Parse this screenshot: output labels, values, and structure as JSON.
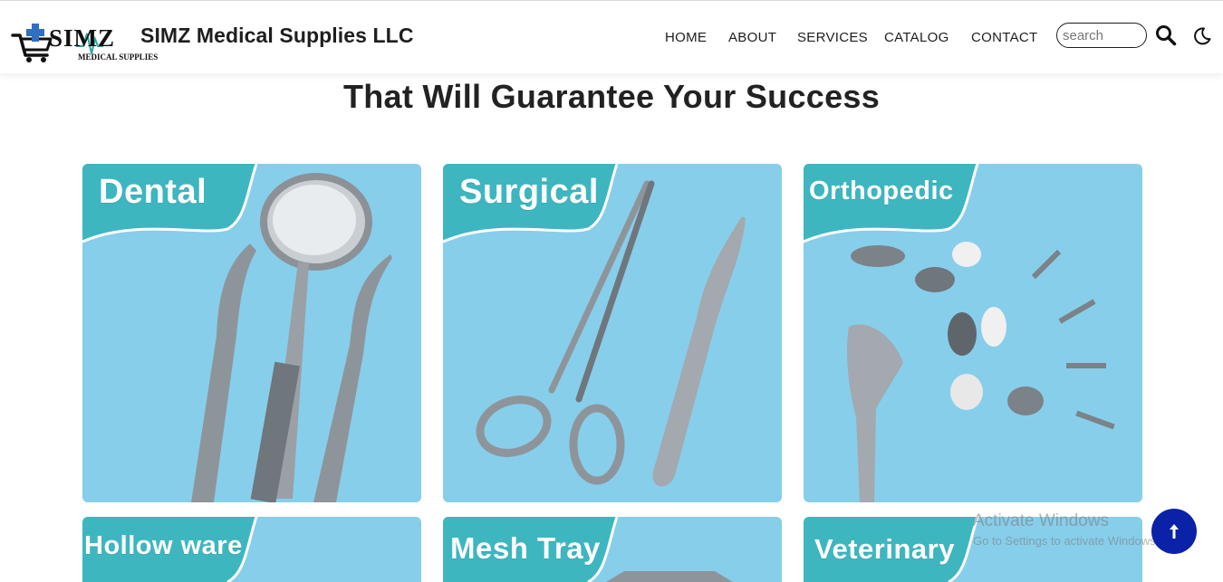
{
  "brand": {
    "name": "SIMZ Medical Supplies LLC",
    "logo_text": "SIMZ",
    "logo_subtext": "MEDICAL SUPPLIES"
  },
  "nav": {
    "items": [
      {
        "label": "HOME"
      },
      {
        "label": "ABOUT"
      },
      {
        "label": "SERVICES"
      },
      {
        "label": "CATALOG"
      },
      {
        "label": "CONTACT"
      }
    ]
  },
  "search": {
    "placeholder": "search",
    "value": ""
  },
  "icons": {
    "search": "search-icon",
    "theme": "moon-icon",
    "to_top": "arrow-up-icon"
  },
  "heading": {
    "line2": "That Will Guarantee Your Success"
  },
  "categories": [
    {
      "label": "Dental"
    },
    {
      "label": "Surgical"
    },
    {
      "label": "Orthopedic"
    },
    {
      "label": "Hollow ware"
    },
    {
      "label": "Mesh Tray"
    },
    {
      "label": "Veterinary"
    }
  ],
  "watermark": {
    "line1": "Activate Windows",
    "line2": "Go to Settings to activate Windows."
  },
  "colors": {
    "card_bg": "#87ceeb",
    "banner_teal": "#3db6c0",
    "accent_blue": "#0a22a8",
    "logo_blue": "#2f6fc4"
  }
}
